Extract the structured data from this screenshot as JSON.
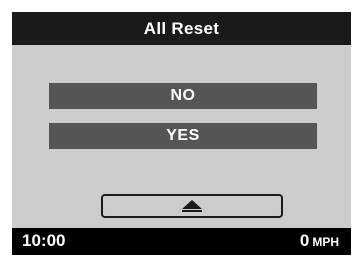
{
  "title": "All Reset",
  "options": {
    "no_label": "NO",
    "yes_label": "YES"
  },
  "up_button": {
    "icon": "triangle-up-icon"
  },
  "status": {
    "time": "10:00",
    "speed": "0",
    "speed_unit": "MPH"
  },
  "colors": {
    "screen_background": "#cccccc",
    "title_bar": "#1a1a1a",
    "option_button": "#555555",
    "status_bar": "#000000",
    "text": "#ffffff"
  }
}
